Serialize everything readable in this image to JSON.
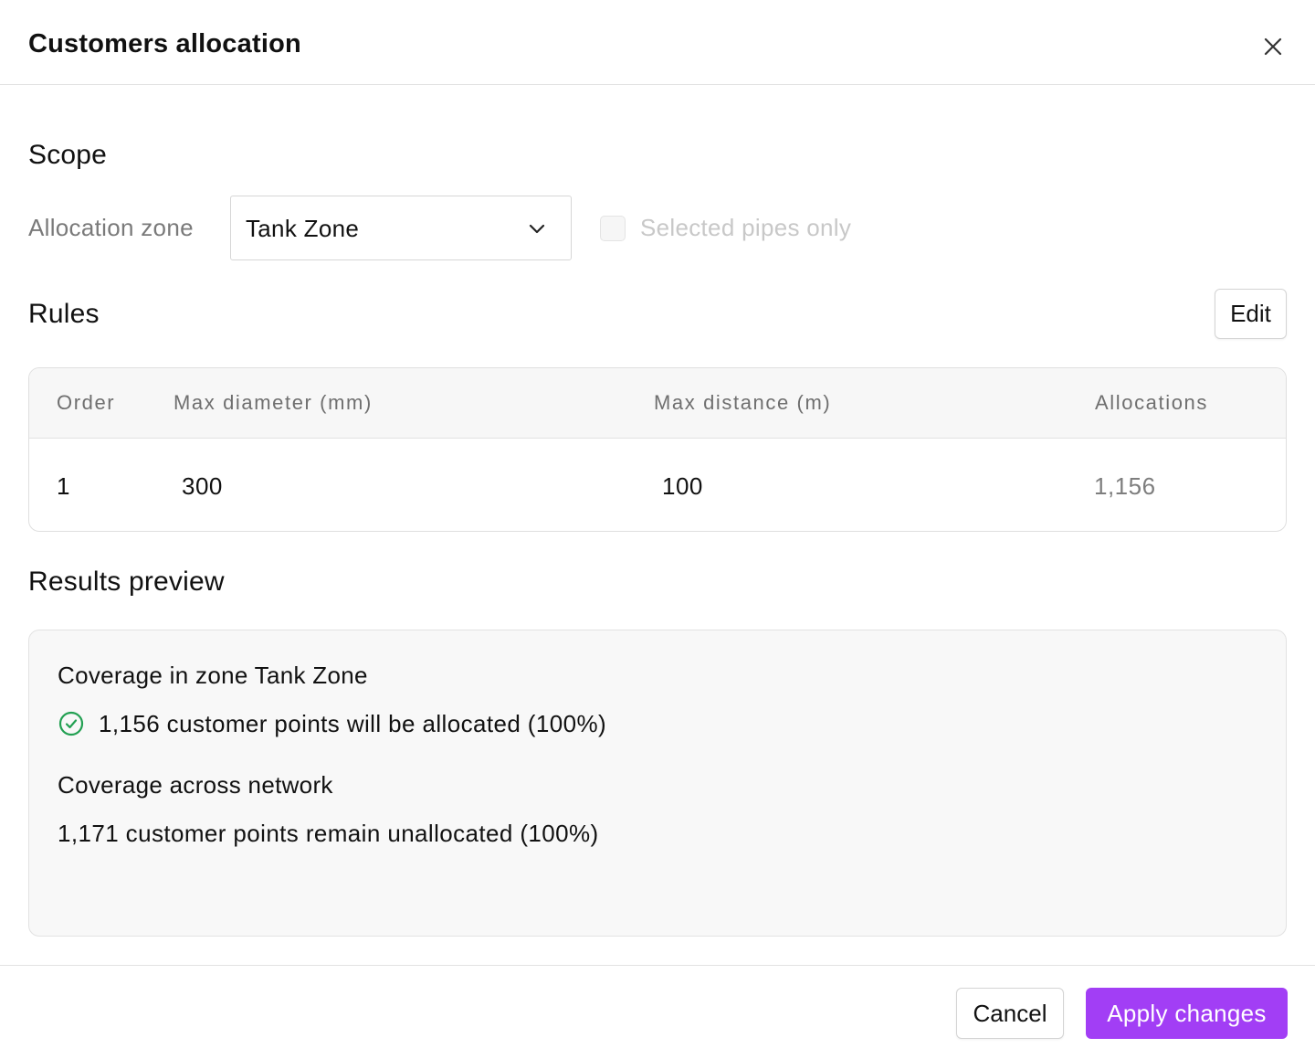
{
  "dialog": {
    "title": "Customers allocation"
  },
  "scope": {
    "title": "Scope",
    "zone_label": "Allocation zone",
    "zone_value": "Tank Zone",
    "selected_pipes_label": "Selected pipes only",
    "selected_pipes_checked": false,
    "selected_pipes_disabled": true
  },
  "rules": {
    "title": "Rules",
    "edit_label": "Edit",
    "columns": [
      "Order",
      "Max diameter (mm)",
      "Max distance (m)",
      "Allocations"
    ],
    "rows": [
      {
        "order": "1",
        "max_diameter": "300",
        "max_distance": "100",
        "allocations": "1,156"
      }
    ]
  },
  "results": {
    "title": "Results preview",
    "zone_heading": "Coverage in zone Tank Zone",
    "zone_line": "1,156 customer points will be allocated (100%)",
    "network_heading": "Coverage across network",
    "network_line": "1,171 customer points remain unallocated (100%)"
  },
  "footer": {
    "cancel_label": "Cancel",
    "apply_label": "Apply changes"
  },
  "colors": {
    "accent": "#a23ef5",
    "success": "#22a052"
  },
  "icons": {
    "close": "close-icon",
    "chevron": "chevron-down-icon",
    "success": "check-circle-icon"
  }
}
